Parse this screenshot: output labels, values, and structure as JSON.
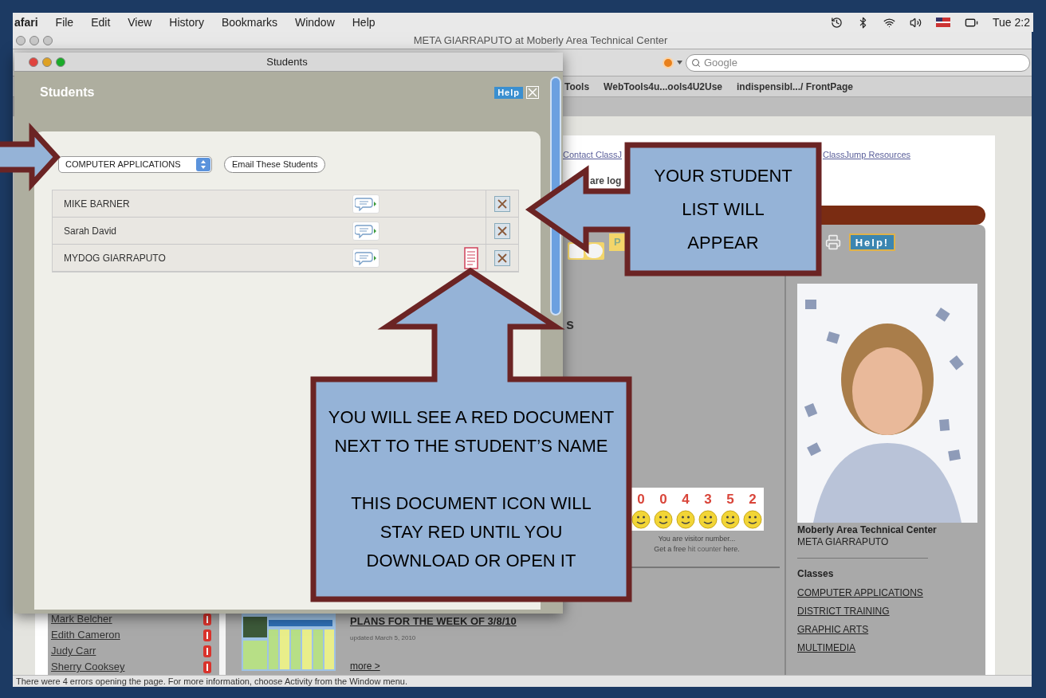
{
  "menu_bar": {
    "app": "afari",
    "menus": [
      "File",
      "Edit",
      "View",
      "History",
      "Bookmarks",
      "Window",
      "Help"
    ],
    "clock": "Tue 2:2"
  },
  "browser": {
    "title": "META GIARRAPUTO at Moberly Area Technical Center",
    "search_placeholder": "Google",
    "bookmarks": [
      "Tools",
      "WebTools4u...ools4U2Use",
      "indispensibl.../ FrontPage"
    ],
    "status": "There were 4 errors opening the page. For more information, choose Activity from the Window menu."
  },
  "page": {
    "top_links": [
      "Contact ClassJ",
      "ClassJump Resources"
    ],
    "login_text": "are log",
    "toolbar_button": "P",
    "help_button": "Help!",
    "heading_fragment": "s",
    "counter": {
      "digits": [
        "0",
        "0",
        "4",
        "3",
        "5",
        "2"
      ],
      "caption": "You are visitor number...",
      "link_prefix": "Get a free",
      "link": "hit counter",
      "link_suffix": "here."
    },
    "profile": {
      "school": "Moberly Area Technical Center",
      "teacher": "META GIARRAPUTO",
      "classes_heading": "Classes",
      "classes": [
        "COMPUTER APPLICATIONS",
        "DISTRICT TRAINING",
        "GRAPHIC ARTS",
        "MULTIMEDIA"
      ]
    },
    "students": [
      {
        "name": "Mark Belcher"
      },
      {
        "name": "Edith Cameron"
      },
      {
        "name": "Judy Carr"
      },
      {
        "name": "Sherry Cooksey"
      }
    ],
    "post": {
      "title": "PLANS FOR THE WEEK OF 3/8/10",
      "updated": "updated March 5, 2010",
      "more": "more >"
    }
  },
  "students_window": {
    "title": "Students",
    "heading": "Students",
    "help": "Help",
    "class_select": "COMPUTER APPLICATIONS",
    "email_button": "Email These Students",
    "rows": [
      {
        "name": "MIKE BARNER",
        "new_document": false
      },
      {
        "name": "Sarah David",
        "new_document": false
      },
      {
        "name": "MYDOG GIARRAPUTO",
        "new_document": true
      }
    ]
  },
  "callouts": [
    {
      "kind": "right"
    },
    {
      "kind": "left",
      "paragraphs": [
        "YOUR STUDENT LIST WILL APPEAR"
      ]
    },
    {
      "kind": "up",
      "paragraphs": [
        "YOU WILL SEE A RED DOCUMENT NEXT TO THE STUDENT’S NAME",
        "THIS DOCUMENT ICON WILL STAY RED UNTIL YOU DOWNLOAD OR OPEN IT"
      ]
    }
  ]
}
